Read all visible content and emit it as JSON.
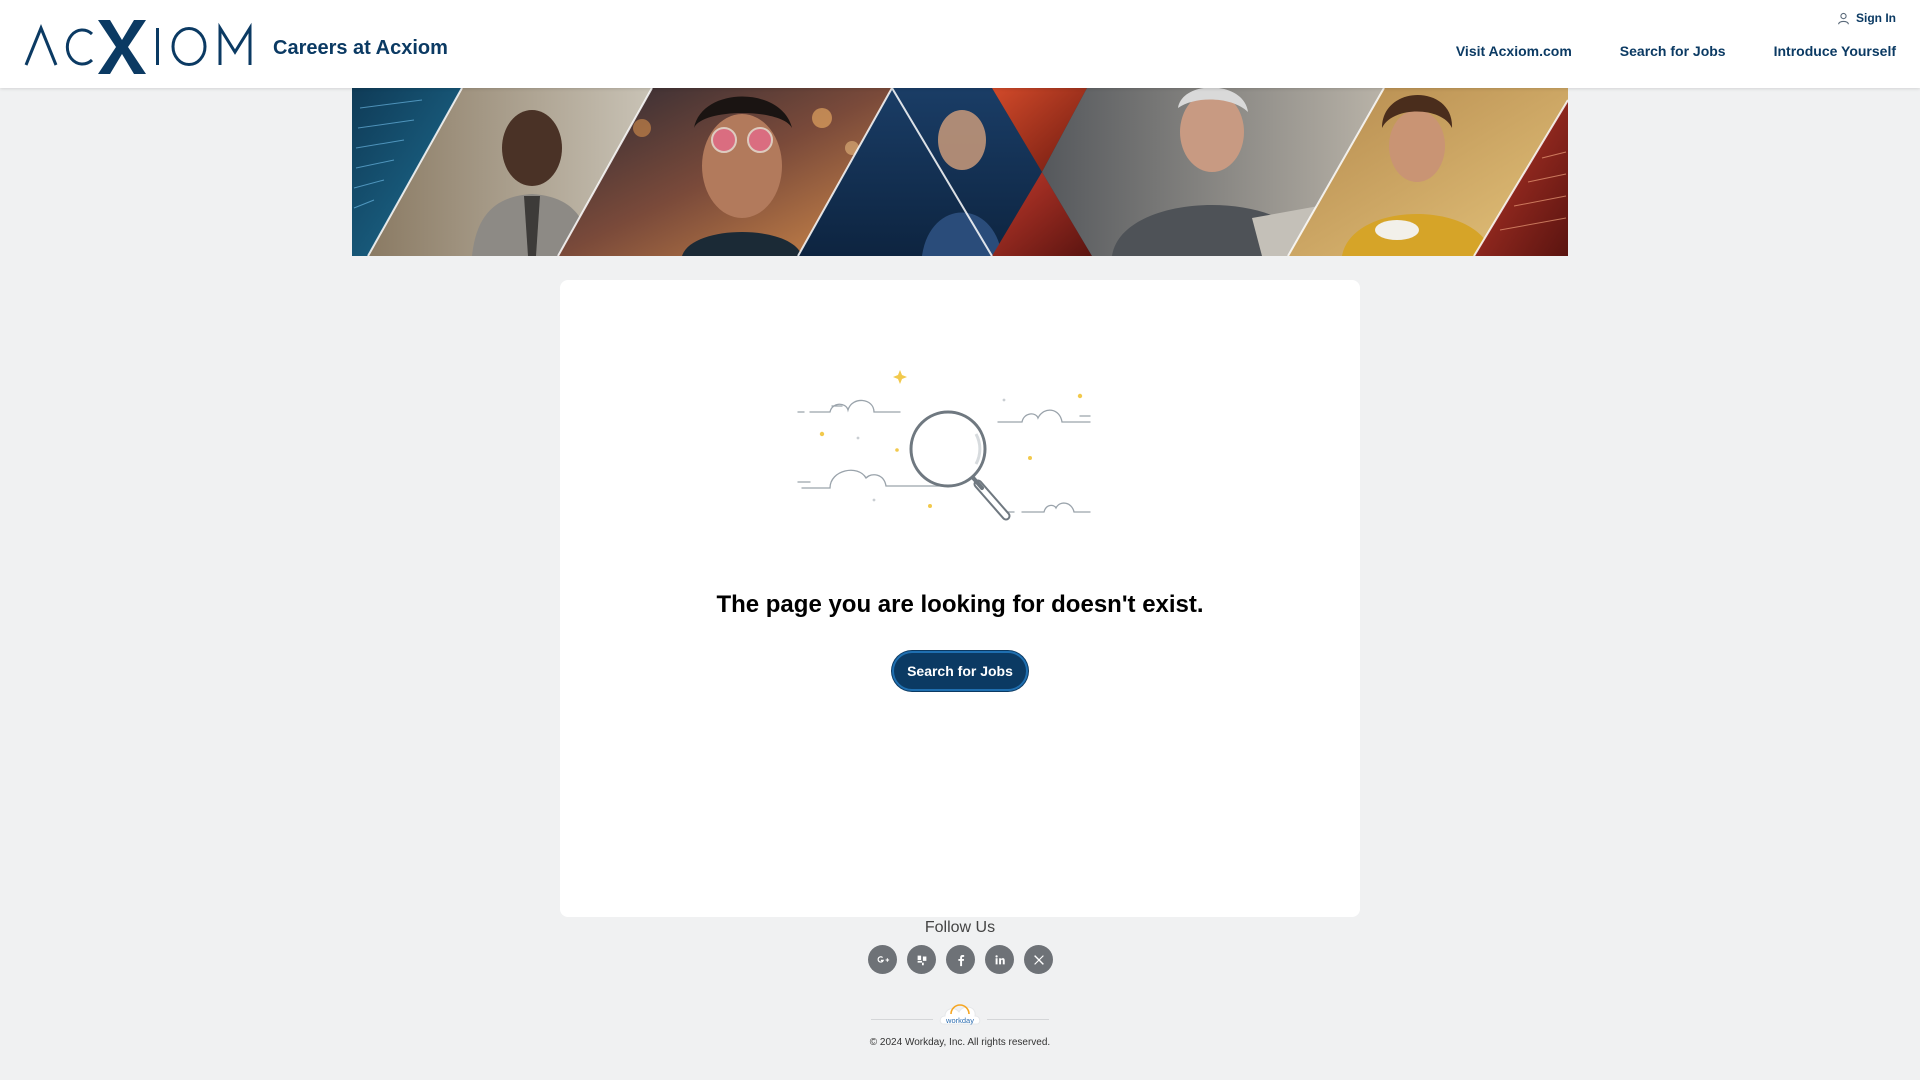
{
  "header": {
    "logo_text": "ACXIOM",
    "site_title": "Careers at Acxiom",
    "sign_in_label": "Sign In",
    "nav": [
      {
        "label": "Visit Acxiom.com"
      },
      {
        "label": "Search for Jobs"
      },
      {
        "label": "Introduce Yourself"
      }
    ]
  },
  "banner": {
    "icon": "photo-collage"
  },
  "main": {
    "illustration_icon": "magnifying-glass-with-clouds",
    "message": "The page you are looking for doesn't exist.",
    "cta_label": "Search for Jobs"
  },
  "footer": {
    "follow_label": "Follow Us",
    "social": [
      {
        "icon": "google-plus-icon"
      },
      {
        "icon": "glassdoor-icon"
      },
      {
        "icon": "facebook-icon"
      },
      {
        "icon": "linkedin-icon"
      },
      {
        "icon": "x-twitter-icon"
      }
    ],
    "powered_by": "workday",
    "copyright": "© 2024 Workday, Inc. All rights reserved."
  },
  "colors": {
    "brand_navy": "#0b3a63",
    "page_bg": "#f0f1f2",
    "card_bg": "#ffffff",
    "social_icon_bg": "#6e7277",
    "sparkle": "#f2c94c"
  }
}
